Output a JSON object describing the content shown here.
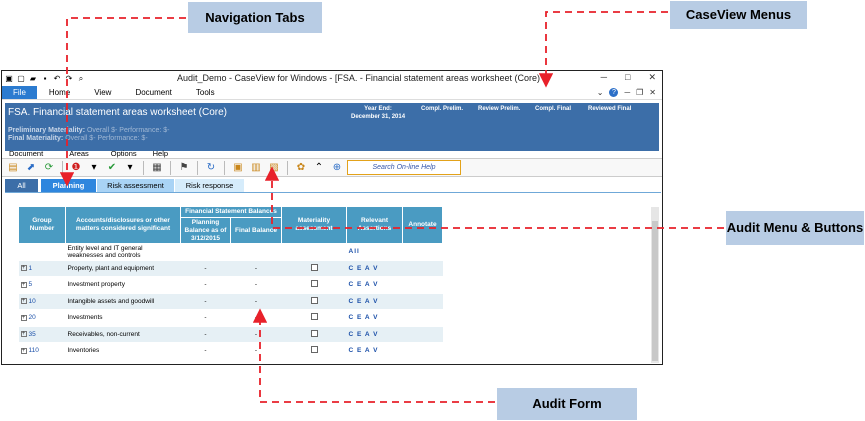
{
  "callouts": {
    "navigation_tabs": "Navigation Tabs",
    "caseview_menus": "CaseView Menus",
    "audit_menu": "Audit Menu & Buttons",
    "audit_form": "Audit Form"
  },
  "window": {
    "title": "Audit_Demo - CaseView for Windows - [FSA. - Financial statement areas worksheet (Core) *]",
    "ribbon_tabs": [
      "File",
      "Home",
      "View",
      "Document",
      "Tools"
    ]
  },
  "header": {
    "form_title": "FSA. Financial statement areas worksheet (Core)",
    "year_end_label": "Year End:",
    "year_end_value": "December 31, 2014",
    "col_compl_prelim": "Compl. Prelim.",
    "col_review_prelim": "Review Prelim.",
    "col_compl_final": "Compl. Final",
    "col_reviewed_final": "Reviewed Final",
    "prelim_label": "Preliminary Materiality:",
    "prelim_values": "Overall $-   Performance: $-",
    "final_label": "Final Materiality:",
    "final_values": "Overall $-   Performance: $-"
  },
  "audit_menu": {
    "items": [
      "Document",
      "Areas",
      "Options",
      "Help"
    ],
    "search_placeholder": "Search On-line Help"
  },
  "nav_tabs": [
    "All",
    "Planning",
    "Risk assessment",
    "Risk response"
  ],
  "table": {
    "headers": {
      "group_number": "Group Number",
      "accounts": "Accounts/disclosures or other matters considered significant",
      "fsb": "Financial Statement Balances",
      "planning_balance": "Planning Balance as of 3/12/2015",
      "final_balance": "Final Balance",
      "materiality": "Materiality assessment",
      "assertions": "Relevant Assertions",
      "annotate": "Annotate"
    },
    "rows": [
      {
        "group": "",
        "account": "Entity level and IT general weaknesses and controls",
        "planning": "",
        "final": "",
        "checkbox": false,
        "assertions": "All"
      },
      {
        "group": "1",
        "account": "Property, plant and equipment",
        "planning": "-",
        "final": "-",
        "checkbox": true,
        "assertions": "C E A V"
      },
      {
        "group": "5",
        "account": "Investment property",
        "planning": "-",
        "final": "-",
        "checkbox": true,
        "assertions": "C E A V"
      },
      {
        "group": "10",
        "account": "Intangible assets and goodwill",
        "planning": "-",
        "final": "-",
        "checkbox": true,
        "assertions": "C E A V"
      },
      {
        "group": "20",
        "account": "Investments",
        "planning": "-",
        "final": "-",
        "checkbox": true,
        "assertions": "C E A V"
      },
      {
        "group": "35",
        "account": "Receivables, non-current",
        "planning": "-",
        "final": "-",
        "checkbox": true,
        "assertions": "C E A V"
      },
      {
        "group": "110",
        "account": "Inventories",
        "planning": "-",
        "final": "-",
        "checkbox": true,
        "assertions": "C E A V"
      }
    ]
  },
  "colors": {
    "header_blue": "#3c6ea8",
    "callout_bg": "#b8cce4",
    "arrow_red": "#e8212a",
    "table_header": "#4a9bc2"
  }
}
